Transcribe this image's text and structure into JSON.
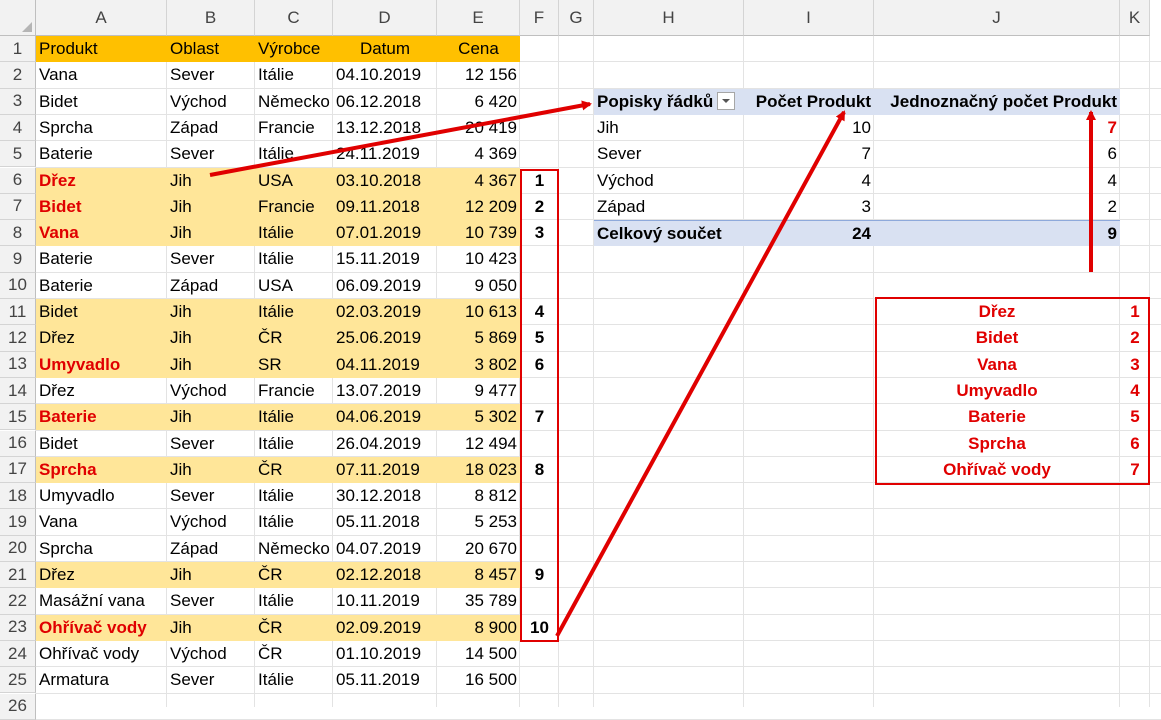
{
  "columns": [
    "A",
    "B",
    "C",
    "D",
    "E",
    "F",
    "G",
    "H",
    "I",
    "J",
    "K"
  ],
  "rows": [
    "1",
    "2",
    "3",
    "4",
    "5",
    "6",
    "7",
    "8",
    "9",
    "10",
    "11",
    "12",
    "13",
    "14",
    "15",
    "16",
    "17",
    "18",
    "19",
    "20",
    "21",
    "22",
    "23",
    "24",
    "25",
    "26"
  ],
  "table": {
    "headers": [
      "Produkt",
      "Oblast",
      "Výrobce",
      "Datum",
      "Cena"
    ],
    "records": [
      {
        "produkt": "Vana",
        "oblast": "Sever",
        "vyrobce": "Itálie",
        "datum": "04.10.2019",
        "cena": "12 156",
        "hl": false,
        "red": false,
        "idx": ""
      },
      {
        "produkt": "Bidet",
        "oblast": "Východ",
        "vyrobce": "Německo",
        "datum": "06.12.2018",
        "cena": "6 420",
        "hl": false,
        "red": false,
        "idx": ""
      },
      {
        "produkt": "Sprcha",
        "oblast": "Západ",
        "vyrobce": "Francie",
        "datum": "13.12.2018",
        "cena": "20 419",
        "hl": false,
        "red": false,
        "idx": ""
      },
      {
        "produkt": "Baterie",
        "oblast": "Sever",
        "vyrobce": "Itálie",
        "datum": "24.11.2019",
        "cena": "4 369",
        "hl": false,
        "red": false,
        "idx": ""
      },
      {
        "produkt": "Dřez",
        "oblast": "Jih",
        "vyrobce": "USA",
        "datum": "03.10.2018",
        "cena": "4 367",
        "hl": true,
        "red": true,
        "idx": "1"
      },
      {
        "produkt": "Bidet",
        "oblast": "Jih",
        "vyrobce": "Francie",
        "datum": "09.11.2018",
        "cena": "12 209",
        "hl": true,
        "red": true,
        "idx": "2"
      },
      {
        "produkt": "Vana",
        "oblast": "Jih",
        "vyrobce": "Itálie",
        "datum": "07.01.2019",
        "cena": "10 739",
        "hl": true,
        "red": true,
        "idx": "3"
      },
      {
        "produkt": "Baterie",
        "oblast": "Sever",
        "vyrobce": "Itálie",
        "datum": "15.11.2019",
        "cena": "10 423",
        "hl": false,
        "red": false,
        "idx": ""
      },
      {
        "produkt": "Baterie",
        "oblast": "Západ",
        "vyrobce": "USA",
        "datum": "06.09.2019",
        "cena": "9 050",
        "hl": false,
        "red": false,
        "idx": ""
      },
      {
        "produkt": "Bidet",
        "oblast": "Jih",
        "vyrobce": "Itálie",
        "datum": "02.03.2019",
        "cena": "10 613",
        "hl": true,
        "red": false,
        "idx": "4"
      },
      {
        "produkt": "Dřez",
        "oblast": "Jih",
        "vyrobce": "ČR",
        "datum": "25.06.2019",
        "cena": "5 869",
        "hl": true,
        "red": false,
        "idx": "5"
      },
      {
        "produkt": "Umyvadlo",
        "oblast": "Jih",
        "vyrobce": "SR",
        "datum": "04.11.2019",
        "cena": "3 802",
        "hl": true,
        "red": true,
        "idx": "6"
      },
      {
        "produkt": "Dřez",
        "oblast": "Východ",
        "vyrobce": "Francie",
        "datum": "13.07.2019",
        "cena": "9 477",
        "hl": false,
        "red": false,
        "idx": ""
      },
      {
        "produkt": "Baterie",
        "oblast": "Jih",
        "vyrobce": "Itálie",
        "datum": "04.06.2019",
        "cena": "5 302",
        "hl": true,
        "red": true,
        "idx": "7"
      },
      {
        "produkt": "Bidet",
        "oblast": "Sever",
        "vyrobce": "Itálie",
        "datum": "26.04.2019",
        "cena": "12 494",
        "hl": false,
        "red": false,
        "idx": ""
      },
      {
        "produkt": "Sprcha",
        "oblast": "Jih",
        "vyrobce": "ČR",
        "datum": "07.11.2019",
        "cena": "18 023",
        "hl": true,
        "red": true,
        "idx": "8"
      },
      {
        "produkt": "Umyvadlo",
        "oblast": "Sever",
        "vyrobce": "Itálie",
        "datum": "30.12.2018",
        "cena": "8 812",
        "hl": false,
        "red": false,
        "idx": ""
      },
      {
        "produkt": "Vana",
        "oblast": "Východ",
        "vyrobce": "Itálie",
        "datum": "05.11.2018",
        "cena": "5 253",
        "hl": false,
        "red": false,
        "idx": ""
      },
      {
        "produkt": "Sprcha",
        "oblast": "Západ",
        "vyrobce": "Německo",
        "datum": "04.07.2019",
        "cena": "20 670",
        "hl": false,
        "red": false,
        "idx": ""
      },
      {
        "produkt": "Dřez",
        "oblast": "Jih",
        "vyrobce": "ČR",
        "datum": "02.12.2018",
        "cena": "8 457",
        "hl": true,
        "red": false,
        "idx": "9"
      },
      {
        "produkt": "Masážní vana",
        "oblast": "Sever",
        "vyrobce": "Itálie",
        "datum": "10.11.2019",
        "cena": "35 789",
        "hl": false,
        "red": false,
        "idx": ""
      },
      {
        "produkt": "Ohřívač vody",
        "oblast": "Jih",
        "vyrobce": "ČR",
        "datum": "02.09.2019",
        "cena": "8 900",
        "hl": true,
        "red": true,
        "idx": "10"
      },
      {
        "produkt": "Ohřívač vody",
        "oblast": "Východ",
        "vyrobce": "ČR",
        "datum": "01.10.2019",
        "cena": "14 500",
        "hl": false,
        "red": false,
        "idx": ""
      },
      {
        "produkt": "Armatura",
        "oblast": "Sever",
        "vyrobce": "Itálie",
        "datum": "05.11.2019",
        "cena": "16 500",
        "hl": false,
        "red": false,
        "idx": ""
      }
    ]
  },
  "pivot": {
    "headers": [
      "Popisky řádků",
      "Počet Produkt",
      "Jednoznačný počet Produkt"
    ],
    "rows": [
      {
        "label": "Jih",
        "count": "10",
        "distinct": "7"
      },
      {
        "label": "Sever",
        "count": "7",
        "distinct": "6"
      },
      {
        "label": "Východ",
        "count": "4",
        "distinct": "4"
      },
      {
        "label": "Západ",
        "count": "3",
        "distinct": "2"
      }
    ],
    "total": {
      "label": "Celkový součet",
      "count": "24",
      "distinct": "9"
    }
  },
  "unique_list": [
    {
      "name": "Dřez",
      "n": "1"
    },
    {
      "name": "Bidet",
      "n": "2"
    },
    {
      "name": "Vana",
      "n": "3"
    },
    {
      "name": "Umyvadlo",
      "n": "4"
    },
    {
      "name": "Baterie",
      "n": "5"
    },
    {
      "name": "Sprcha",
      "n": "6"
    },
    {
      "name": "Ohřívač vody",
      "n": "7"
    }
  ],
  "colors": {
    "highlight": "#ffe699",
    "header_band": "#ffc000",
    "pivot_band": "#d9e1f2",
    "annotation": "#e00000"
  }
}
